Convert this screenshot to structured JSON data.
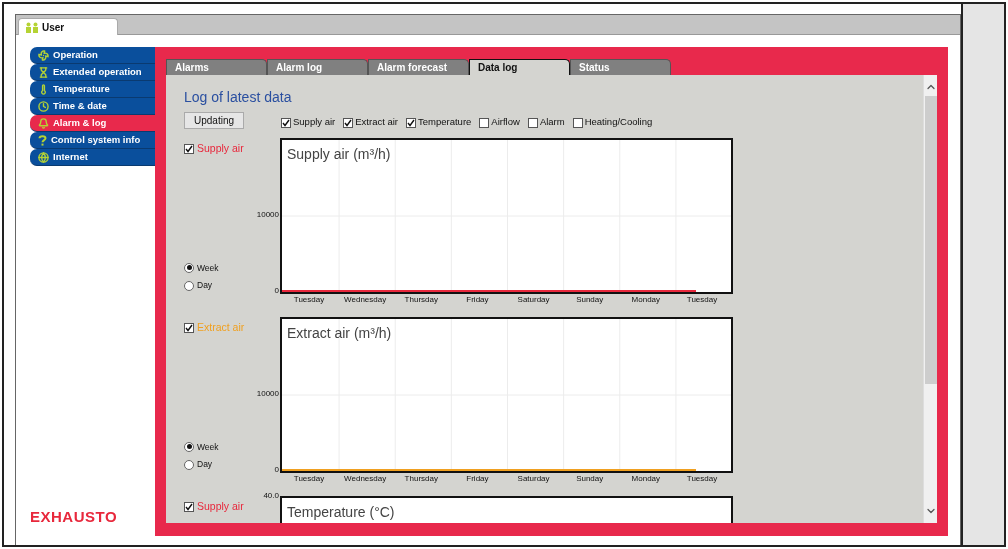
{
  "window": {
    "tab": "User"
  },
  "sidebar": {
    "items": [
      {
        "label": "Operation",
        "selected": false
      },
      {
        "label": "Extended operation",
        "selected": false
      },
      {
        "label": "Temperature",
        "selected": false
      },
      {
        "label": "Time & date",
        "selected": false
      },
      {
        "label": "Alarm & log",
        "selected": true
      },
      {
        "label": "Control system info",
        "selected": false
      },
      {
        "label": "Internet",
        "selected": false
      }
    ],
    "logo": "EXHAUSTO"
  },
  "tabs": [
    {
      "label": "Alarms",
      "selected": false
    },
    {
      "label": "Alarm log",
      "selected": false
    },
    {
      "label": "Alarm forecast",
      "selected": false
    },
    {
      "label": "Data log",
      "selected": true
    },
    {
      "label": "Status",
      "selected": false
    }
  ],
  "panel": {
    "title": "Log of latest data",
    "button": "Updating",
    "filters": [
      {
        "label": "Supply air",
        "checked": true
      },
      {
        "label": "Extract air",
        "checked": true
      },
      {
        "label": "Temperature",
        "checked": true
      },
      {
        "label": "Airflow",
        "checked": false
      },
      {
        "label": "Alarm",
        "checked": false
      },
      {
        "label": "Heating/Cooling",
        "checked": false
      }
    ]
  },
  "sections": [
    {
      "label": "Supply air",
      "checked": true,
      "color": "#e8283c",
      "chart_title": "Supply air (m³/h)",
      "y_labels": [
        "10000",
        "0"
      ],
      "x_labels": [
        "Tuesday",
        "Wednesday",
        "Thursday",
        "Friday",
        "Saturday",
        "Sunday",
        "Monday",
        "Tuesday"
      ],
      "ranges": [
        {
          "label": "Week",
          "selected": true
        },
        {
          "label": "Day",
          "selected": false
        }
      ]
    },
    {
      "label": "Extract air",
      "checked": true,
      "color": "#f0a020",
      "chart_title": "Extract air (m³/h)",
      "y_labels": [
        "10000",
        "0"
      ],
      "x_labels": [
        "Tuesday",
        "Wednesday",
        "Thursday",
        "Friday",
        "Saturday",
        "Sunday",
        "Monday",
        "Tuesday"
      ],
      "ranges": [
        {
          "label": "Week",
          "selected": true
        },
        {
          "label": "Day",
          "selected": false
        }
      ]
    },
    {
      "label": "Supply air",
      "checked": true,
      "color": "#e8283c",
      "chart_title": "Temperature (°C)",
      "y_labels": [
        "40.0"
      ]
    }
  ]
}
